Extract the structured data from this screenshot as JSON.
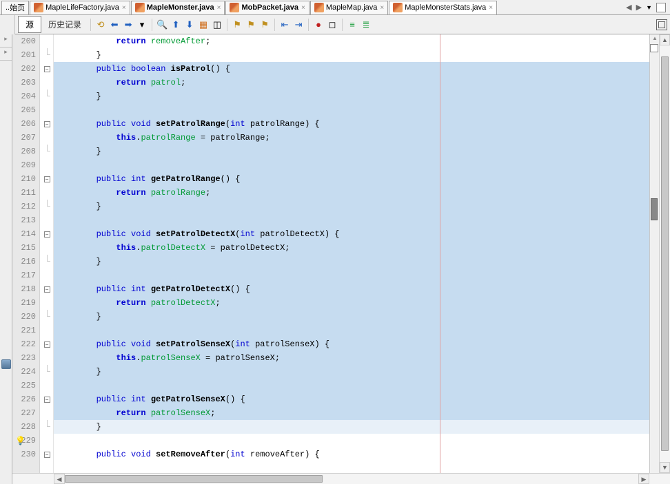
{
  "tabs": {
    "home": "始页",
    "t1": "MapleLifeFactory.java",
    "t2": "MapleMonster.java",
    "t3": "MobPacket.java",
    "t4": "MapleMap.java",
    "t5": "MapleMonsterStats.java"
  },
  "toolbar": {
    "source": "源",
    "history": "历史记录"
  },
  "lines": [
    {
      "num": "200",
      "fold": "",
      "hl": false,
      "code": "            <span class='kw-bold'>return</span> <span class='field'>removeAfter</span>;"
    },
    {
      "num": "201",
      "fold": "end",
      "hl": false,
      "code": "        }"
    },
    {
      "num": "202",
      "fold": "start",
      "hl": true,
      "code": "        <span class='kw'>public</span> <span class='kw'>boolean</span> <span class='fn'>isPatrol</span>() {"
    },
    {
      "num": "203",
      "fold": "",
      "hl": true,
      "code": "            <span class='kw-bold'>return</span> <span class='field'>patrol</span>;"
    },
    {
      "num": "204",
      "fold": "end",
      "hl": true,
      "code": "        }"
    },
    {
      "num": "205",
      "fold": "",
      "hl": true,
      "code": ""
    },
    {
      "num": "206",
      "fold": "start",
      "hl": true,
      "code": "        <span class='kw'>public</span> <span class='kw'>void</span> <span class='fn'>setPatrolRange</span>(<span class='kw'>int</span> patrolRange) {"
    },
    {
      "num": "207",
      "fold": "",
      "hl": true,
      "code": "            <span class='kw-bold'>this</span>.<span class='field'>patrolRange</span> = patrolRange;"
    },
    {
      "num": "208",
      "fold": "end",
      "hl": true,
      "code": "        }"
    },
    {
      "num": "209",
      "fold": "",
      "hl": true,
      "code": ""
    },
    {
      "num": "210",
      "fold": "start",
      "hl": true,
      "code": "        <span class='kw'>public</span> <span class='kw'>int</span> <span class='fn'>getPatrolRange</span>() {"
    },
    {
      "num": "211",
      "fold": "",
      "hl": true,
      "code": "            <span class='kw-bold'>return</span> <span class='field'>patrolRange</span>;"
    },
    {
      "num": "212",
      "fold": "end",
      "hl": true,
      "code": "        }"
    },
    {
      "num": "213",
      "fold": "",
      "hl": true,
      "code": ""
    },
    {
      "num": "214",
      "fold": "start",
      "hl": true,
      "code": "        <span class='kw'>public</span> <span class='kw'>void</span> <span class='fn'>setPatrolDetectX</span>(<span class='kw'>int</span> patrolDetectX) {"
    },
    {
      "num": "215",
      "fold": "",
      "hl": true,
      "code": "            <span class='kw-bold'>this</span>.<span class='field'>patrolDetectX</span> = patrolDetectX;"
    },
    {
      "num": "216",
      "fold": "end",
      "hl": true,
      "code": "        }"
    },
    {
      "num": "217",
      "fold": "",
      "hl": true,
      "code": ""
    },
    {
      "num": "218",
      "fold": "start",
      "hl": true,
      "code": "        <span class='kw'>public</span> <span class='kw'>int</span> <span class='fn'>getPatrolDetectX</span>() {"
    },
    {
      "num": "219",
      "fold": "",
      "hl": true,
      "code": "            <span class='kw-bold'>return</span> <span class='field'>patrolDetectX</span>;"
    },
    {
      "num": "220",
      "fold": "end",
      "hl": true,
      "code": "        }"
    },
    {
      "num": "221",
      "fold": "",
      "hl": true,
      "code": ""
    },
    {
      "num": "222",
      "fold": "start",
      "hl": true,
      "code": "        <span class='kw'>public</span> <span class='kw'>void</span> <span class='fn'>setPatrolSenseX</span>(<span class='kw'>int</span> patrolSenseX) {"
    },
    {
      "num": "223",
      "fold": "",
      "hl": true,
      "code": "            <span class='kw-bold'>this</span>.<span class='field'>patrolSenseX</span> = patrolSenseX;"
    },
    {
      "num": "224",
      "fold": "end",
      "hl": true,
      "code": "        }"
    },
    {
      "num": "225",
      "fold": "",
      "hl": true,
      "code": ""
    },
    {
      "num": "226",
      "fold": "start",
      "hl": true,
      "code": "        <span class='kw'>public</span> <span class='kw'>int</span> <span class='fn'>getPatrolSenseX</span>() {"
    },
    {
      "num": "227",
      "fold": "",
      "hl": true,
      "code": "            <span class='kw-bold'>return</span> <span class='field'>patrolSenseX</span>;"
    },
    {
      "num": "228",
      "fold": "end",
      "hl": true,
      "cur": true,
      "code": "        }"
    },
    {
      "num": "229",
      "fold": "",
      "hl": false,
      "code": ""
    },
    {
      "num": "230",
      "fold": "start",
      "hl": false,
      "code": "        <span class='kw'>public</span> <span class='kw'>void</span> <span class='fn'>setRemoveAfter</span>(<span class='kw'>int</span> removeAfter) {"
    }
  ]
}
